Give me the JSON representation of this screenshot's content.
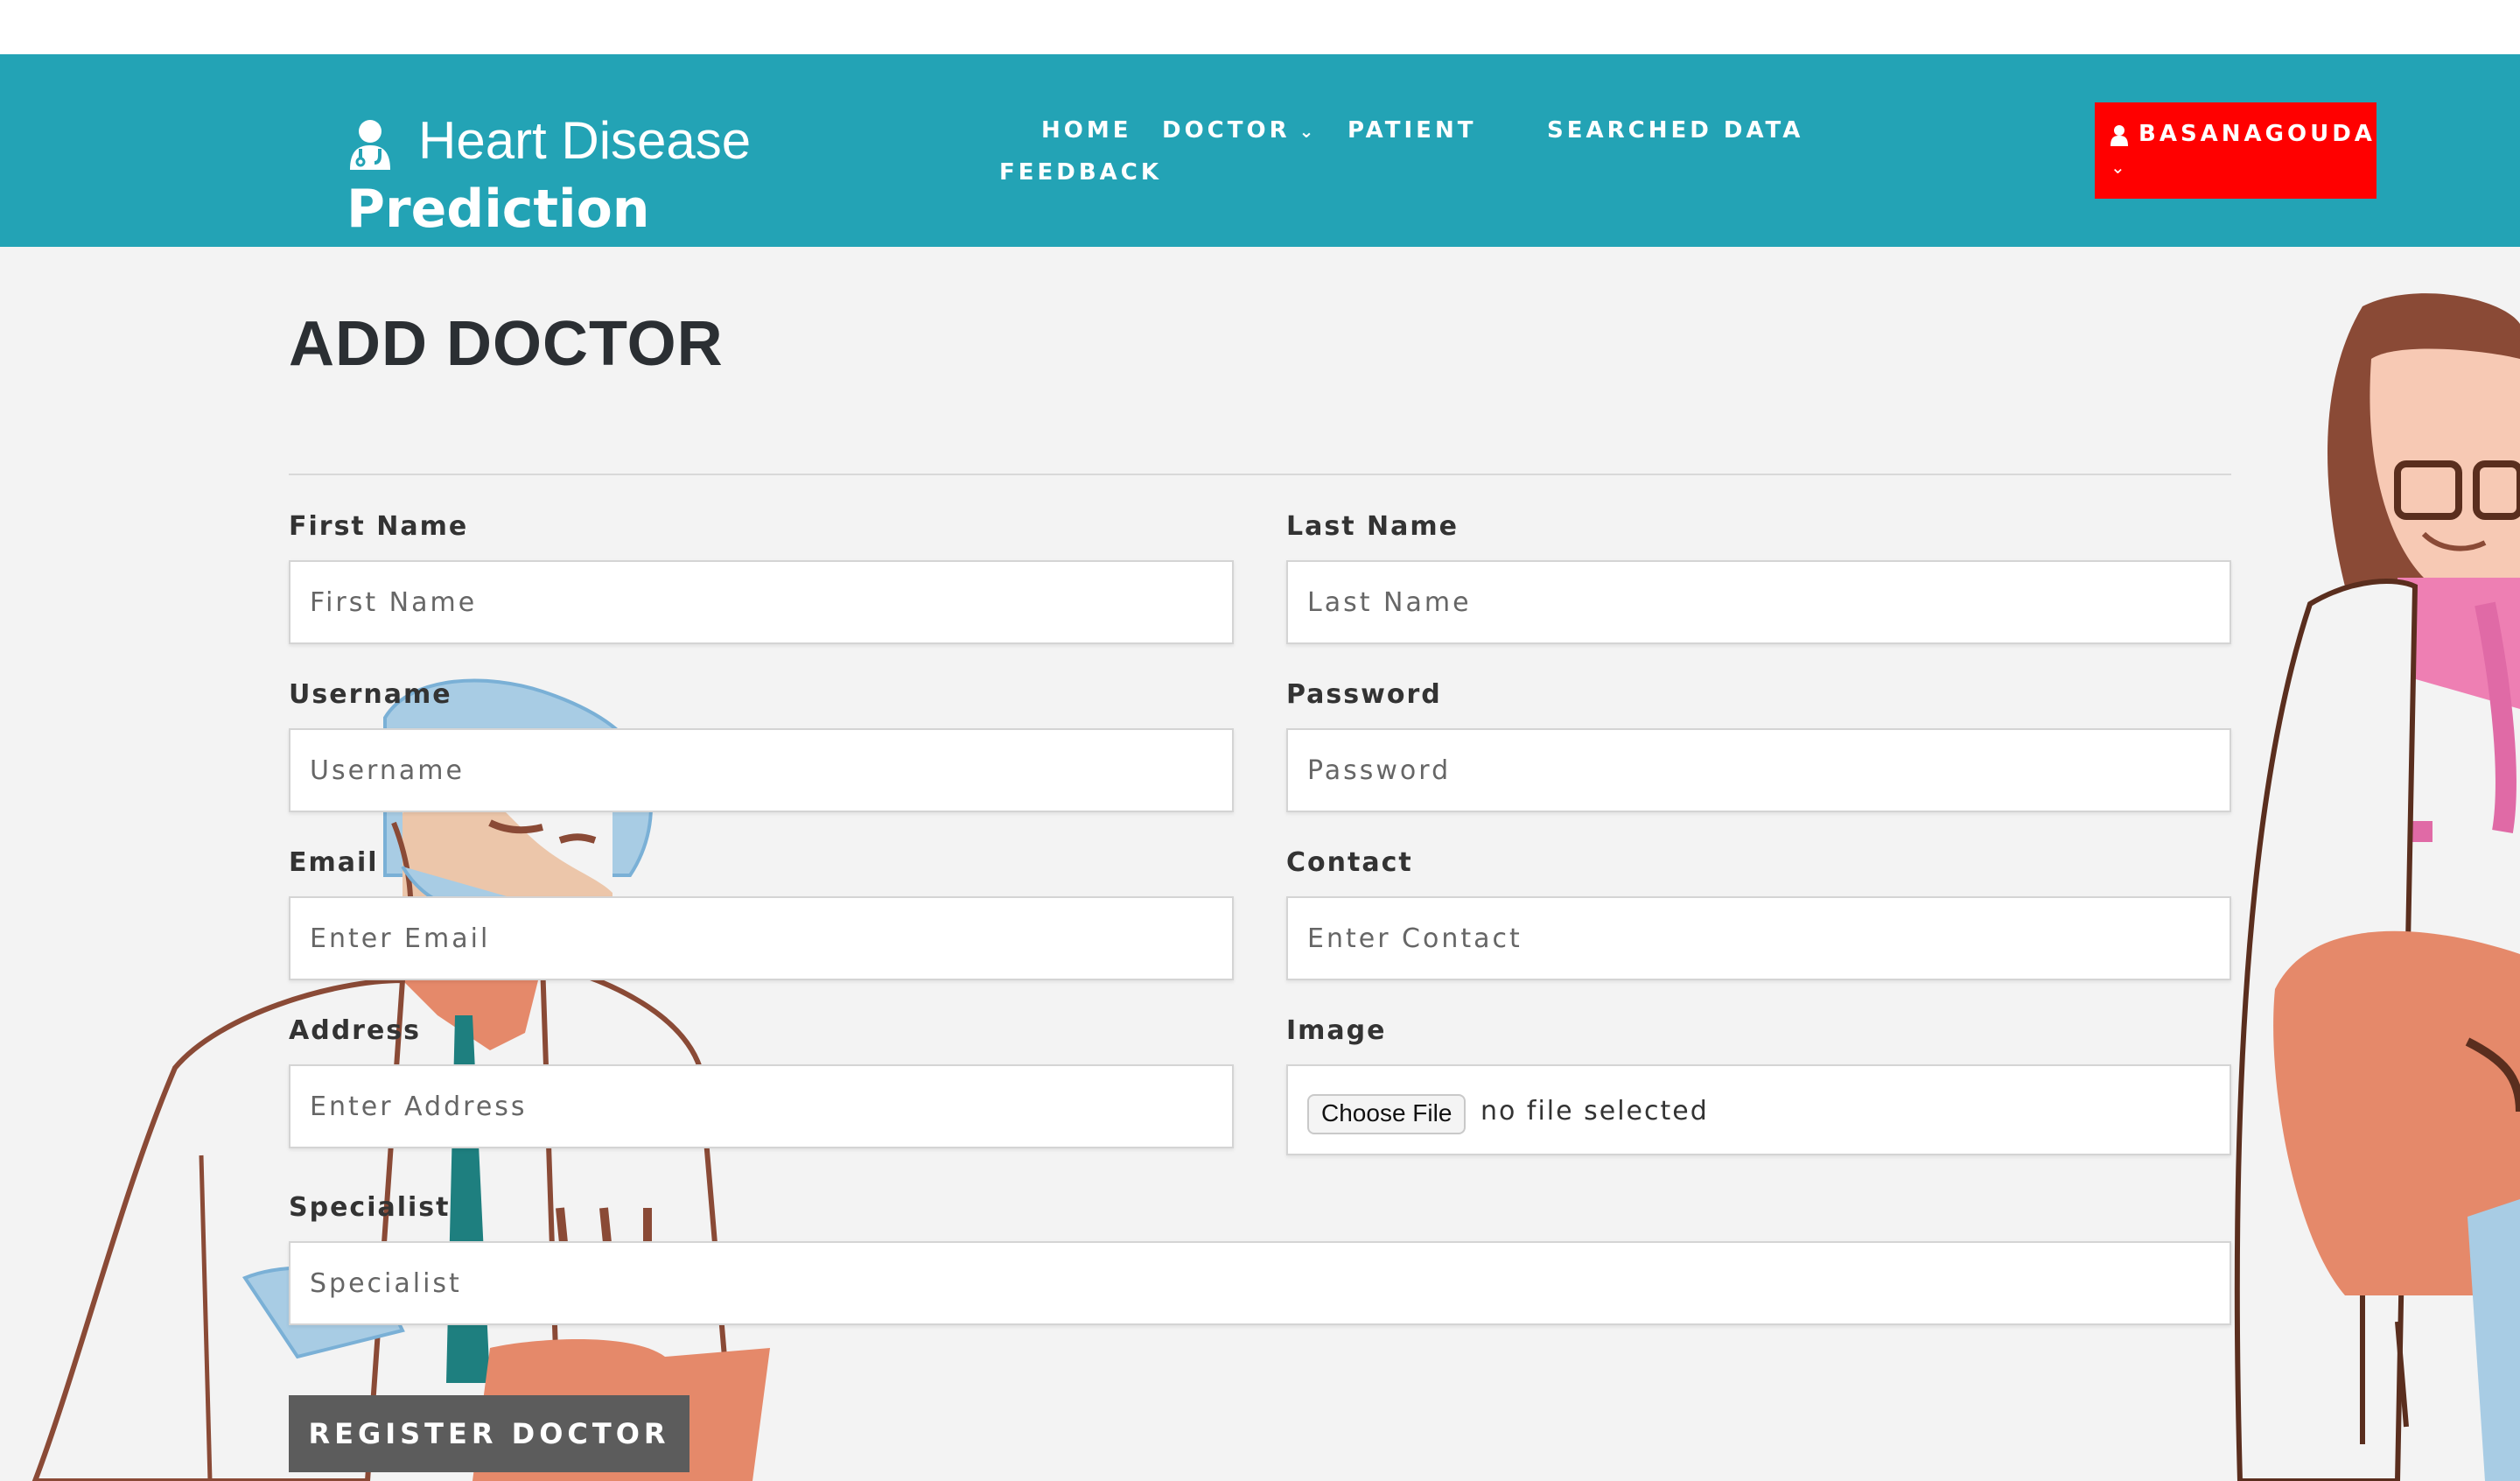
{
  "brand": {
    "line1": "Heart Disease",
    "line2": "Prediction",
    "icon": "doctor-user-icon"
  },
  "nav": {
    "home": "HOME",
    "doctor": "DOCTOR",
    "patient": "PATIENT",
    "searched": "SEARCHED DATA",
    "feedback": "FEEDBACK",
    "chevron": "chevron-down-icon"
  },
  "user": {
    "name": "BASANAGOUDA",
    "icon": "user-icon"
  },
  "page": {
    "title": "ADD DOCTOR"
  },
  "form": {
    "first_name": {
      "label": "First Name",
      "placeholder": "First Name"
    },
    "last_name": {
      "label": "Last Name",
      "placeholder": "Last Name"
    },
    "username": {
      "label": "Username",
      "placeholder": "Username"
    },
    "password": {
      "label": "Password",
      "placeholder": "Password"
    },
    "email": {
      "label": "Email",
      "placeholder": "Enter Email"
    },
    "contact": {
      "label": "Contact",
      "placeholder": "Enter Contact"
    },
    "address": {
      "label": "Address",
      "placeholder": "Enter Address"
    },
    "image": {
      "label": "Image",
      "button": "Choose File",
      "status": "no file selected"
    },
    "specialist": {
      "label": "Specialist",
      "placeholder": "Specialist"
    },
    "submit": "REGISTER DOCTOR"
  },
  "colors": {
    "navbar": "#23a3b5",
    "user_button": "#ff0000",
    "submit_button": "#5c5c5c",
    "background": "#f3f3f3"
  }
}
